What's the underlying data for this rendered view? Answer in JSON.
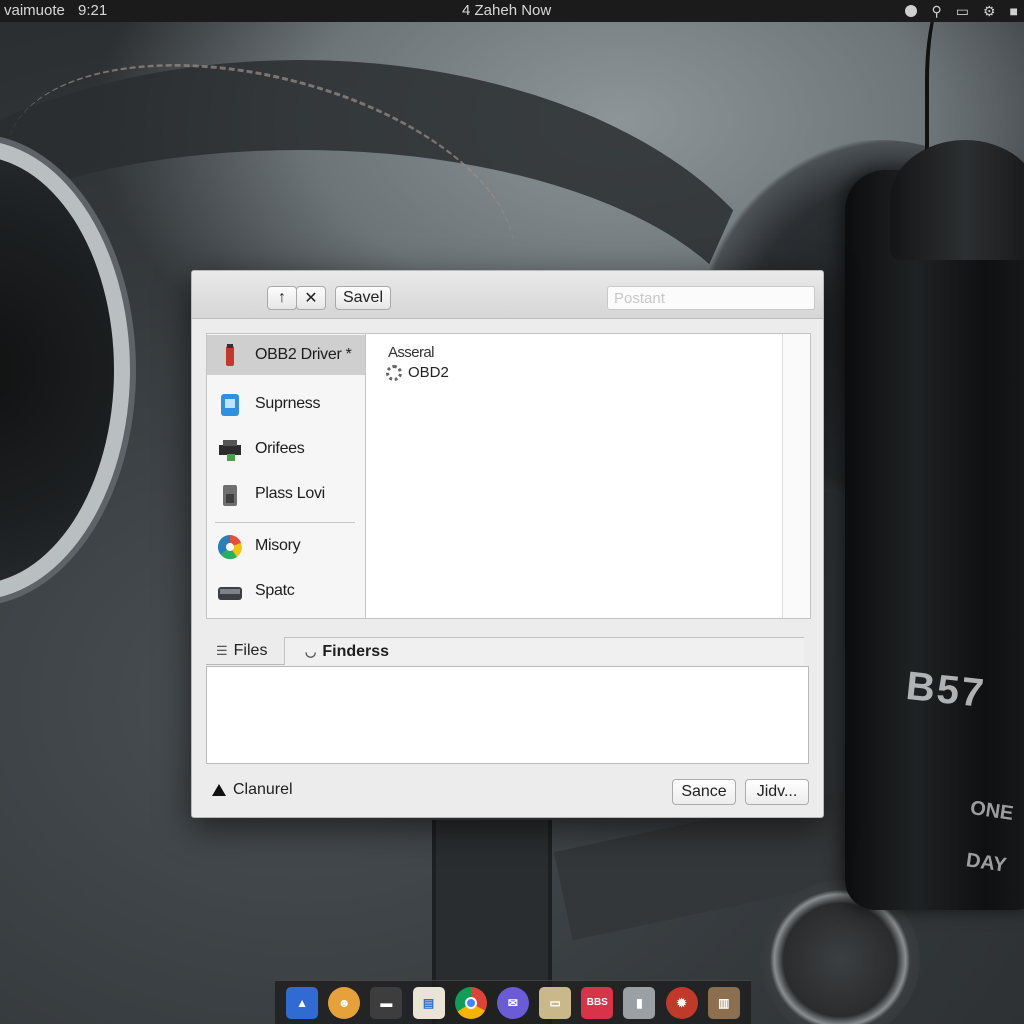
{
  "menubar": {
    "app_name": "vaimuote",
    "clock": "9:21",
    "center_status": "4 Zaheh Now"
  },
  "dialog": {
    "toolbar": {
      "up_label": "↑",
      "delete_label": "✕",
      "save_label": "Savel"
    },
    "search": {
      "placeholder": "Postant"
    },
    "sidebar": {
      "items": [
        {
          "label": "OBB2 Driver *",
          "icon": "obd-driver-icon",
          "selected": true
        },
        {
          "label": "Suprness",
          "icon": "document-icon",
          "selected": false
        },
        {
          "label": "Orifees",
          "icon": "printer-icon",
          "selected": false
        },
        {
          "label": "Plass Lovi",
          "icon": "drive-icon",
          "selected": false
        },
        {
          "label": "Misory",
          "icon": "color-wheel-icon",
          "selected": false
        },
        {
          "label": "Spatc",
          "icon": "disk-icon",
          "selected": false
        }
      ]
    },
    "file_pane": {
      "header": "Asseral",
      "rows": [
        {
          "label": "OBD2",
          "icon": "gear-icon"
        }
      ]
    },
    "tabs": [
      {
        "label": "Files",
        "icon": "files-icon"
      },
      {
        "label": "Finderss",
        "icon": "finder-icon"
      }
    ],
    "footer": {
      "disclosure_label": "Clanurel",
      "cancel_label": "Sance",
      "confirm_label": "Jidv..."
    }
  },
  "wallpaper": {
    "device_text": "B57",
    "device_line1": "ONE",
    "device_line2": "DAY"
  },
  "dock": {
    "items": [
      {
        "icon": "app-store-icon",
        "color": "#2f6bd3"
      },
      {
        "icon": "smiley-icon",
        "color": "#e6a13a"
      },
      {
        "icon": "terminal-icon",
        "color": "#3d3d3d"
      },
      {
        "icon": "preview-icon",
        "color": "#e9e4d6"
      },
      {
        "icon": "chrome-icon",
        "color": "#db4437"
      },
      {
        "icon": "messages-icon",
        "color": "#6b5bd6"
      },
      {
        "icon": "folder-icon",
        "color": "#c9b98a"
      },
      {
        "icon": "calendar-icon",
        "color": "#d9334a"
      },
      {
        "icon": "usb-device-icon",
        "color": "#9aa0a4"
      },
      {
        "icon": "settings-icon",
        "color": "#c0392b"
      },
      {
        "icon": "trash-icon",
        "color": "#8b6f4e"
      }
    ],
    "calendar_text": "BBS"
  }
}
